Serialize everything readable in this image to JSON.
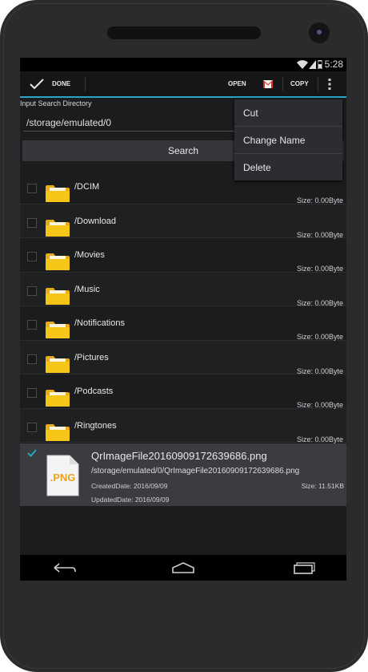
{
  "status": {
    "time": "5:28"
  },
  "actionbar": {
    "done_label": "DONE",
    "open_label": "OPEN",
    "copy_label": "COPY"
  },
  "search": {
    "label": "Input Search Directory",
    "value": "/storage/emulated/0",
    "button_label": "Search"
  },
  "folders": [
    {
      "name": "/DCIM",
      "size": "Size: 0.00Byte"
    },
    {
      "name": "/Download",
      "size": "Size: 0.00Byte"
    },
    {
      "name": "/Movies",
      "size": "Size: 0.00Byte"
    },
    {
      "name": "/Music",
      "size": "Size: 0.00Byte"
    },
    {
      "name": "/Notifications",
      "size": "Size: 0.00Byte"
    },
    {
      "name": "/Pictures",
      "size": "Size: 0.00Byte"
    },
    {
      "name": "/Podcasts",
      "size": "Size: 0.00Byte"
    },
    {
      "name": "/Ringtones",
      "size": "Size: 0.00Byte"
    }
  ],
  "file": {
    "name": "QrImageFile20160909172639686.png",
    "path": "/storage/emulated/0/QrImageFile20160909172639686.png",
    "created": "CreatedDate:  2016/09/09",
    "size": "Size: 11.51KB",
    "updated": "UpdatedDate:  2016/09/09",
    "icon_text": ".PNG",
    "checked": true
  },
  "menu": {
    "items": [
      "Cut",
      "Change Name",
      "Delete"
    ]
  },
  "colors": {
    "accent": "#2aa3c7",
    "folder": "#f5c518",
    "gmail": "#d93025"
  }
}
